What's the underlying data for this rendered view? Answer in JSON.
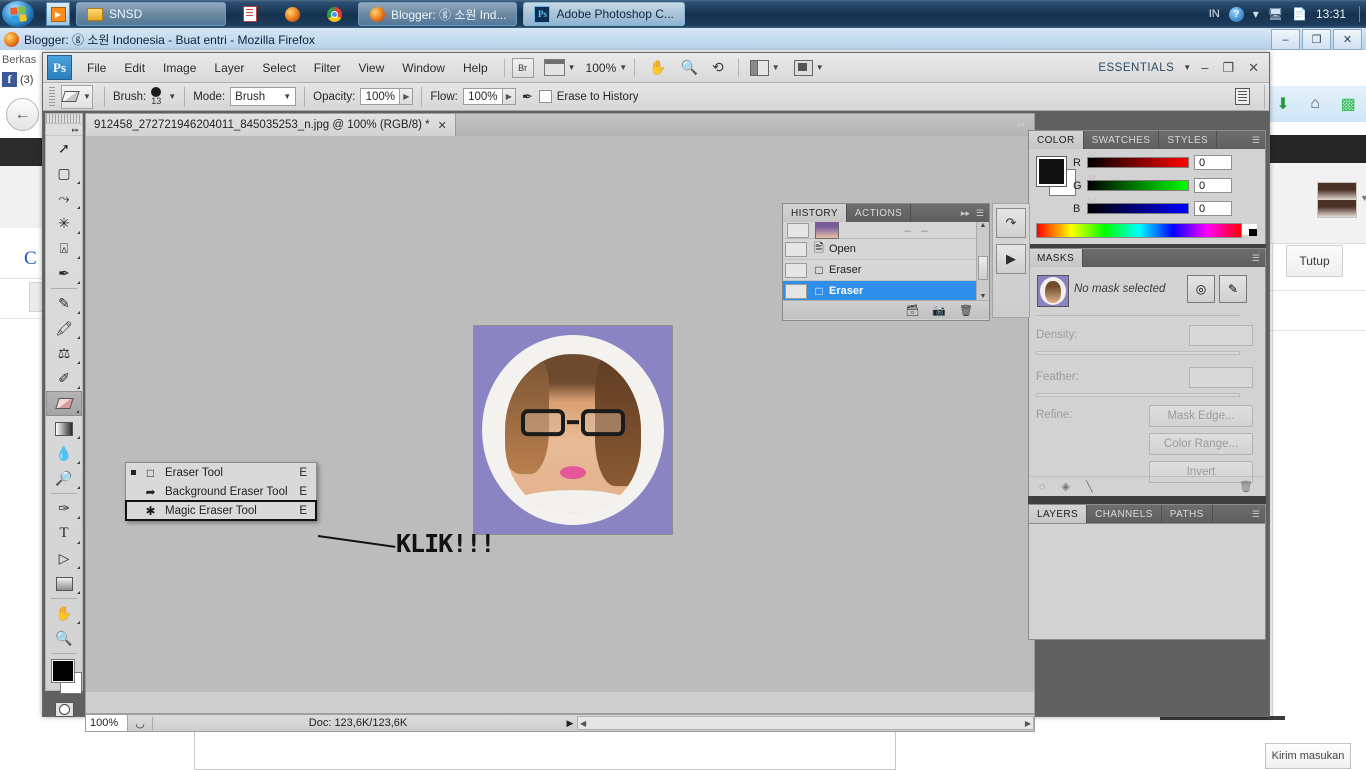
{
  "taskbar": {
    "start_icon": "windows-orb-icon",
    "quicklaunch": [
      {
        "name": "media-player-icon",
        "glyph": "▶"
      }
    ],
    "items": [
      {
        "label": "SNSD",
        "icon": "folder-icon",
        "state": "window"
      },
      {
        "label": "",
        "icon": "document-icon",
        "state": "plain"
      },
      {
        "label": "",
        "icon": "firefox-icon",
        "state": "plain"
      },
      {
        "label": "",
        "icon": "chrome-icon",
        "state": "plain"
      },
      {
        "label": "Blogger: ⓖ 소원 Ind...",
        "icon": "firefox-icon",
        "state": "window"
      },
      {
        "label": "Adobe Photoshop C...",
        "icon": "photoshop-icon",
        "state": "active"
      }
    ],
    "tray": {
      "language": "IN",
      "help": "?",
      "network_icon": "network-icon",
      "action_center_icon": "action-center-icon",
      "clock": "13:31"
    }
  },
  "firefox": {
    "title": "Blogger: ⓖ 소원 Indonesia - Buat entri - Mozilla Firefox",
    "window_buttons": [
      "–",
      "❐",
      "✕"
    ],
    "menu_berkas": "Berkas",
    "facebook_badge": "(3)",
    "facebook_letter": "f",
    "back_icon": "back-arrow-icon",
    "toolbar_icons": [
      "download-icon",
      "home-icon",
      "signal-icon"
    ],
    "close_button": "Tutup",
    "feedback_button": "Kirim masukan"
  },
  "photoshop": {
    "logo": "Ps",
    "menus": [
      "File",
      "Edit",
      "Image",
      "Layer",
      "Select",
      "Filter",
      "View",
      "Window",
      "Help"
    ],
    "bridge_label": "Br",
    "zoom_level": "100%",
    "workspace": "ESSENTIALS",
    "window_buttons": [
      "–",
      "❐",
      "✕"
    ],
    "options": {
      "tool_icon": "eraser-tool-icon",
      "brush_label": "Brush:",
      "brush_size": "13",
      "mode_label": "Mode:",
      "mode_value": "Brush",
      "opacity_label": "Opacity:",
      "opacity_value": "100%",
      "flow_label": "Flow:",
      "flow_value": "100%",
      "airbrush_icon": "airbrush-icon",
      "erase_to_history_label": "Erase to History",
      "palette_icon": "palettes-icon"
    },
    "document": {
      "tab_title": "912458_272721946204011_845035253_n.jpg @ 100% (RGB/8) *",
      "close_glyph": "✕"
    },
    "status": {
      "zoom": "100%",
      "doc_info": "Doc: 123,6K/123,6K"
    },
    "tools": [
      {
        "name": "move-tool",
        "glyph": "⬉"
      },
      {
        "name": "marquee-tool",
        "glyph": "⬚"
      },
      {
        "name": "lasso-tool",
        "glyph": "⌇"
      },
      {
        "name": "magic-wand-tool",
        "glyph": "✳"
      },
      {
        "name": "crop-tool",
        "glyph": "⌗"
      },
      {
        "name": "eyedropper-tool",
        "glyph": "✒"
      },
      {
        "name": "healing-brush-tool",
        "glyph": "✐"
      },
      {
        "name": "brush-tool",
        "glyph": "✎"
      },
      {
        "name": "clone-stamp-tool",
        "glyph": "⚑"
      },
      {
        "name": "history-brush-tool",
        "glyph": "✄"
      },
      {
        "name": "eraser-tool",
        "glyph": "▰"
      },
      {
        "name": "gradient-tool",
        "glyph": "▤"
      },
      {
        "name": "blur-tool",
        "glyph": "●"
      },
      {
        "name": "dodge-tool",
        "glyph": "⚲"
      },
      {
        "name": "pen-tool",
        "glyph": "✑"
      },
      {
        "name": "type-tool",
        "glyph": "T"
      },
      {
        "name": "path-selection-tool",
        "glyph": "➤"
      },
      {
        "name": "shape-tool",
        "glyph": "▧"
      },
      {
        "name": "hand-tool",
        "glyph": "✋"
      },
      {
        "name": "zoom-tool",
        "glyph": "⚲"
      }
    ],
    "flyout": {
      "items": [
        {
          "label": "Eraser Tool",
          "shortcut": "E",
          "selected": true,
          "icon": "eraser-icon"
        },
        {
          "label": "Background Eraser Tool",
          "shortcut": "E",
          "selected": false,
          "icon": "background-eraser-icon"
        },
        {
          "label": "Magic Eraser Tool",
          "shortcut": "E",
          "selected": false,
          "icon": "magic-eraser-icon",
          "highlighted": true
        }
      ]
    },
    "annotation": {
      "text": "KLIK!!!"
    },
    "history_panel": {
      "tabs": [
        {
          "label": "HISTORY",
          "active": true
        },
        {
          "label": "ACTIONS",
          "active": false
        }
      ],
      "items": [
        {
          "label": "Open",
          "icon": "document-icon",
          "selected": false
        },
        {
          "label": "Eraser",
          "icon": "eraser-icon",
          "selected": false
        },
        {
          "label": "Eraser",
          "icon": "eraser-icon",
          "selected": true
        }
      ],
      "footer_icons": [
        "new-document-icon",
        "new-snapshot-icon",
        "delete-icon"
      ]
    },
    "right_strip_buttons": [
      "history-toggle-icon",
      "play-icon"
    ],
    "color_panel": {
      "tabs": [
        {
          "label": "COLOR",
          "active": true
        },
        {
          "label": "SWATCHES",
          "active": false
        },
        {
          "label": "STYLES",
          "active": false
        }
      ],
      "channels": [
        {
          "label": "R",
          "value": "0",
          "color": "#ff0000"
        },
        {
          "label": "G",
          "value": "0",
          "color": "#00ff00"
        },
        {
          "label": "B",
          "value": "0",
          "color": "#0000ff"
        }
      ],
      "foreground": "#000000",
      "background": "#ffffff"
    },
    "masks_panel": {
      "tabs": [
        {
          "label": "MASKS",
          "active": true
        }
      ],
      "status": "No mask selected",
      "density_label": "Density:",
      "feather_label": "Feather:",
      "refine_label": "Refine:",
      "buttons": [
        "Mask Edge...",
        "Color Range...",
        "Invert"
      ],
      "header_icons": [
        "add-pixel-mask-icon",
        "add-vector-mask-icon"
      ],
      "footer_icons": [
        "load-selection-icon",
        "apply-mask-icon",
        "disable-mask-icon",
        "delete-mask-icon"
      ]
    },
    "layers_panel": {
      "tabs": [
        {
          "label": "LAYERS",
          "active": true
        },
        {
          "label": "CHANNELS",
          "active": false
        },
        {
          "label": "PATHS",
          "active": false
        }
      ]
    }
  }
}
